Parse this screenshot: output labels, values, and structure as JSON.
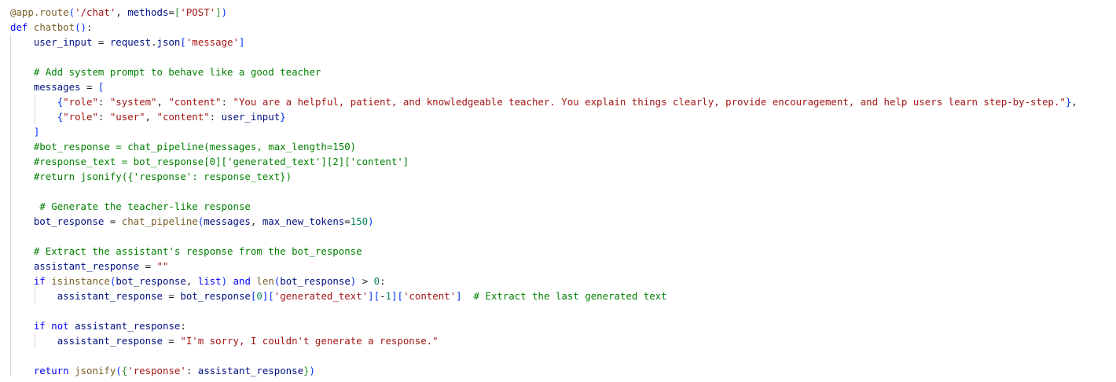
{
  "editor": {
    "language": "python",
    "colors": {
      "keyword": "#0000ff",
      "string": "#a31515",
      "comment": "#008000",
      "function": "#795e26",
      "variable": "#001080",
      "number": "#098658",
      "bracket": "#0431fa",
      "plain": "#1f1f1f",
      "indent_guide": "#d6d6d6"
    },
    "lines": [
      {
        "text": "@app.route('/chat', methods=['POST'])"
      },
      {
        "text": "def chatbot():"
      },
      {
        "text": "    user_input = request.json['message']"
      },
      {
        "text": ""
      },
      {
        "text": "    # Add system prompt to behave like a good teacher"
      },
      {
        "text": "    messages = ["
      },
      {
        "text": "        {\"role\": \"system\", \"content\": \"You are a helpful, patient, and knowledgeable teacher. You explain things clearly, provide encouragement, and help users learn step-by-step.\"},"
      },
      {
        "text": "        {\"role\": \"user\", \"content\": user_input}"
      },
      {
        "text": "    ]"
      },
      {
        "text": "    #bot_response = chat_pipeline(messages, max_length=150)"
      },
      {
        "text": "    #response_text = bot_response[0]['generated_text'][2]['content']"
      },
      {
        "text": "    #return jsonify({'response': response_text})"
      },
      {
        "text": ""
      },
      {
        "text": "     # Generate the teacher-like response"
      },
      {
        "text": "    bot_response = chat_pipeline(messages, max_new_tokens=150)"
      },
      {
        "text": ""
      },
      {
        "text": "    # Extract the assistant's response from the bot_response"
      },
      {
        "text": "    assistant_response = \"\""
      },
      {
        "text": "    if isinstance(bot_response, list) and len(bot_response) > 0:"
      },
      {
        "text": "        assistant_response = bot_response[0]['generated_text'][-1]['content']  # Extract the last generated text"
      },
      {
        "text": ""
      },
      {
        "text": "    if not assistant_response:"
      },
      {
        "text": "        assistant_response = \"I'm sorry, I couldn't generate a response.\""
      },
      {
        "text": ""
      },
      {
        "text": "    return jsonify({'response': assistant_response})"
      }
    ]
  }
}
